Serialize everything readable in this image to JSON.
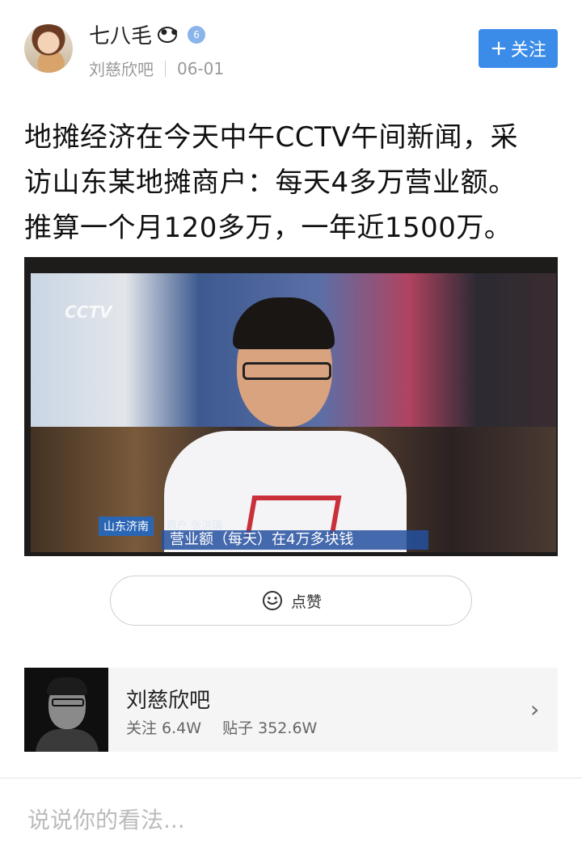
{
  "post": {
    "author_name": "七八毛",
    "author_badges": [
      "panda-icon",
      "verified-badge-icon"
    ],
    "verified_badge_text": "6",
    "forum_label": "刘慈欣吧",
    "date": "06-01",
    "follow_label": "关注",
    "text_lines": [
      "地摊经济在今天中午CCTV午间新闻，采",
      "访山东某地摊商户：每天4多万营业额。",
      "推算一个月120多万，一年近1500万。"
    ]
  },
  "photo": {
    "logo": "CCTV",
    "caption_location": "山东济南",
    "caption_label": "商户 张洪瑞",
    "caption_main": "营业额（每天）在4万多块钱"
  },
  "like": {
    "label": "点赞",
    "icon": "thumbs-up-icon"
  },
  "forum_card": {
    "name": "刘慈欣吧",
    "follow_stat": "关注 6.4W",
    "posts_stat": "贴子 352.6W",
    "chevron_icon": "chevron-right-icon"
  },
  "comment": {
    "placeholder": "说说你的看法..."
  },
  "colors": {
    "accent": "#3b8ce9",
    "meta_text": "#999999",
    "card_bg": "#f5f5f5"
  }
}
